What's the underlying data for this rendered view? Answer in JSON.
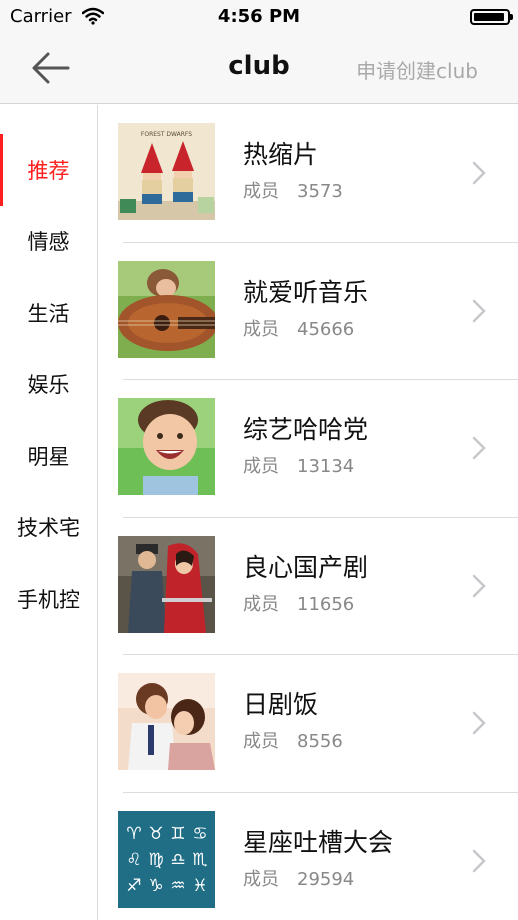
{
  "status_bar": {
    "carrier": "Carrier",
    "time": "4:56 PM",
    "battery_level": 0.95
  },
  "nav": {
    "back_icon": "back-arrow-icon",
    "title": "club",
    "action_label": "申请创建club"
  },
  "sidebar": {
    "items": [
      {
        "label": "推荐",
        "active": true
      },
      {
        "label": "情感",
        "active": false
      },
      {
        "label": "生活",
        "active": false
      },
      {
        "label": "娱乐",
        "active": false
      },
      {
        "label": "明星",
        "active": false
      },
      {
        "label": "技术宅",
        "active": false
      },
      {
        "label": "手机控",
        "active": false
      }
    ]
  },
  "clubs": [
    {
      "name": "热缩片",
      "member_label": "成员",
      "members": "3573"
    },
    {
      "name": "就爱听音乐",
      "member_label": "成员",
      "members": "45666"
    },
    {
      "name": "综艺哈哈党",
      "member_label": "成员",
      "members": "13134"
    },
    {
      "name": "良心国产剧",
      "member_label": "成员",
      "members": "11656"
    },
    {
      "name": "日剧饭",
      "member_label": "成员",
      "members": "8556"
    },
    {
      "name": "星座吐槽大会",
      "member_label": "成员",
      "members": "29594"
    }
  ],
  "thumbnail_texts": {
    "forest_dwarfs": "FOREST DWARFS"
  },
  "colors": {
    "accent": "#ff1e1e",
    "muted_text": "#888888",
    "nav_action": "#a9a9a9"
  }
}
